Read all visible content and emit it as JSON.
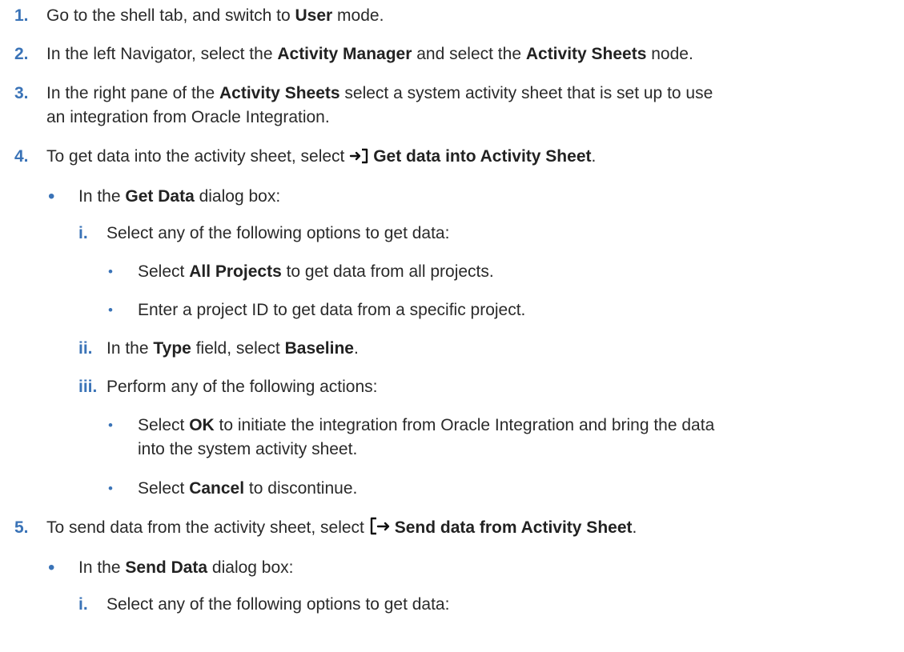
{
  "steps": {
    "s1": {
      "num": "1.",
      "a": "Go to the shell tab, and switch to ",
      "b": "User",
      "c": " mode."
    },
    "s2": {
      "num": "2.",
      "a": "In the left Navigator, select the ",
      "b": "Activity Manager",
      "c": " and select the ",
      "d": "Activity Sheets",
      "e": " node."
    },
    "s3": {
      "num": "3.",
      "a": "In the right pane of the ",
      "b": "Activity Sheets",
      "c": " select a system activity sheet that is set up to use",
      "line2": "an integration from Oracle Integration."
    },
    "s4": {
      "num": "4.",
      "a": "To get data into the activity sheet, select ",
      "b": "Get data into Activity Sheet",
      "c": ".",
      "icon": "get-data-into-icon",
      "bullet": {
        "a": "In the ",
        "b": "Get Data",
        "c": " dialog box:"
      },
      "i": {
        "num": "i.",
        "a": "Select any of the following options to get data:",
        "o1": {
          "a": "Select ",
          "b": "All Projects",
          "c": " to get data from all projects."
        },
        "o2": {
          "a": "Enter a project ID to get data from a specific project."
        }
      },
      "ii": {
        "num": "ii.",
        "a": "In the ",
        "b": "Type",
        "c": " field, select ",
        "d": "Baseline",
        "e": "."
      },
      "iii": {
        "num": "iii.",
        "a": "Perform any of the following actions:",
        "o1": {
          "a": "Select ",
          "b": "OK",
          "c": " to initiate the integration from Oracle Integration and bring the data",
          "line2": "into the system activity sheet."
        },
        "o2": {
          "a": "Select ",
          "b": "Cancel",
          "c": " to discontinue."
        }
      }
    },
    "s5": {
      "num": "5.",
      "a": "To send data from the activity sheet, select ",
      "b": "Send data from Activity Sheet",
      "c": ".",
      "icon": "send-data-from-icon",
      "bullet": {
        "a": "In the ",
        "b": "Send Data",
        "c": " dialog box:"
      },
      "i": {
        "num": "i.",
        "a": "Select any of the following options to get data:"
      }
    }
  }
}
